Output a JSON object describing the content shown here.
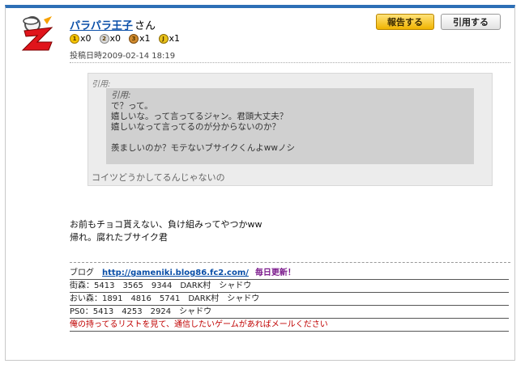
{
  "post": {
    "username": "パラパラ王子",
    "honorific": "さん",
    "medals": [
      {
        "badge": "1",
        "count": "x0",
        "color": "#f5c400"
      },
      {
        "badge": "2",
        "count": "x0",
        "color": "#c8c8c8"
      },
      {
        "badge": "3",
        "count": "x1",
        "color": "#d08a2e"
      },
      {
        "badge": "J",
        "count": "x1",
        "color": "#e8c21a"
      }
    ],
    "posted_label": "投稿日時2009-02-14 18:19"
  },
  "buttons": {
    "report_label": "報告する",
    "quote_label": "引用する"
  },
  "quote": {
    "outer_label": "引用:",
    "inner_label": "引用:",
    "inner_lines": [
      "で？って。",
      "嬉しいな。って言ってるジャン。君頭大丈夫？",
      "嬉しいなって言ってるのが分からないのか？",
      "",
      "羨ましいのか？モテないブサイクくんよwwノシ"
    ],
    "outer_text": "コイツどうかしてるんじゃないの"
  },
  "body": {
    "lines": [
      "お前もチョコ貰えない、負け組みってやつかww",
      "帰れ。腐れたブサイク君"
    ]
  },
  "signature": {
    "blog_label": "ブログ",
    "blog_url": "http://gameniki.blog86.fc2.com/",
    "blog_update": "毎日更新！",
    "line1": "街森：5413　3565　9344　DARK村　シャドウ",
    "line2": "おい森：1891　4816　5741　DARK村　シャドウ",
    "line3": "PS0：5413　4253　2924　シャドウ",
    "line4": "俺の持ってるリストを見て、通信したいゲームがあればメールください"
  },
  "colors": {
    "accent_bar": "#2d6fb6",
    "link": "#0a4fa8",
    "warning_text": "#c00000"
  }
}
